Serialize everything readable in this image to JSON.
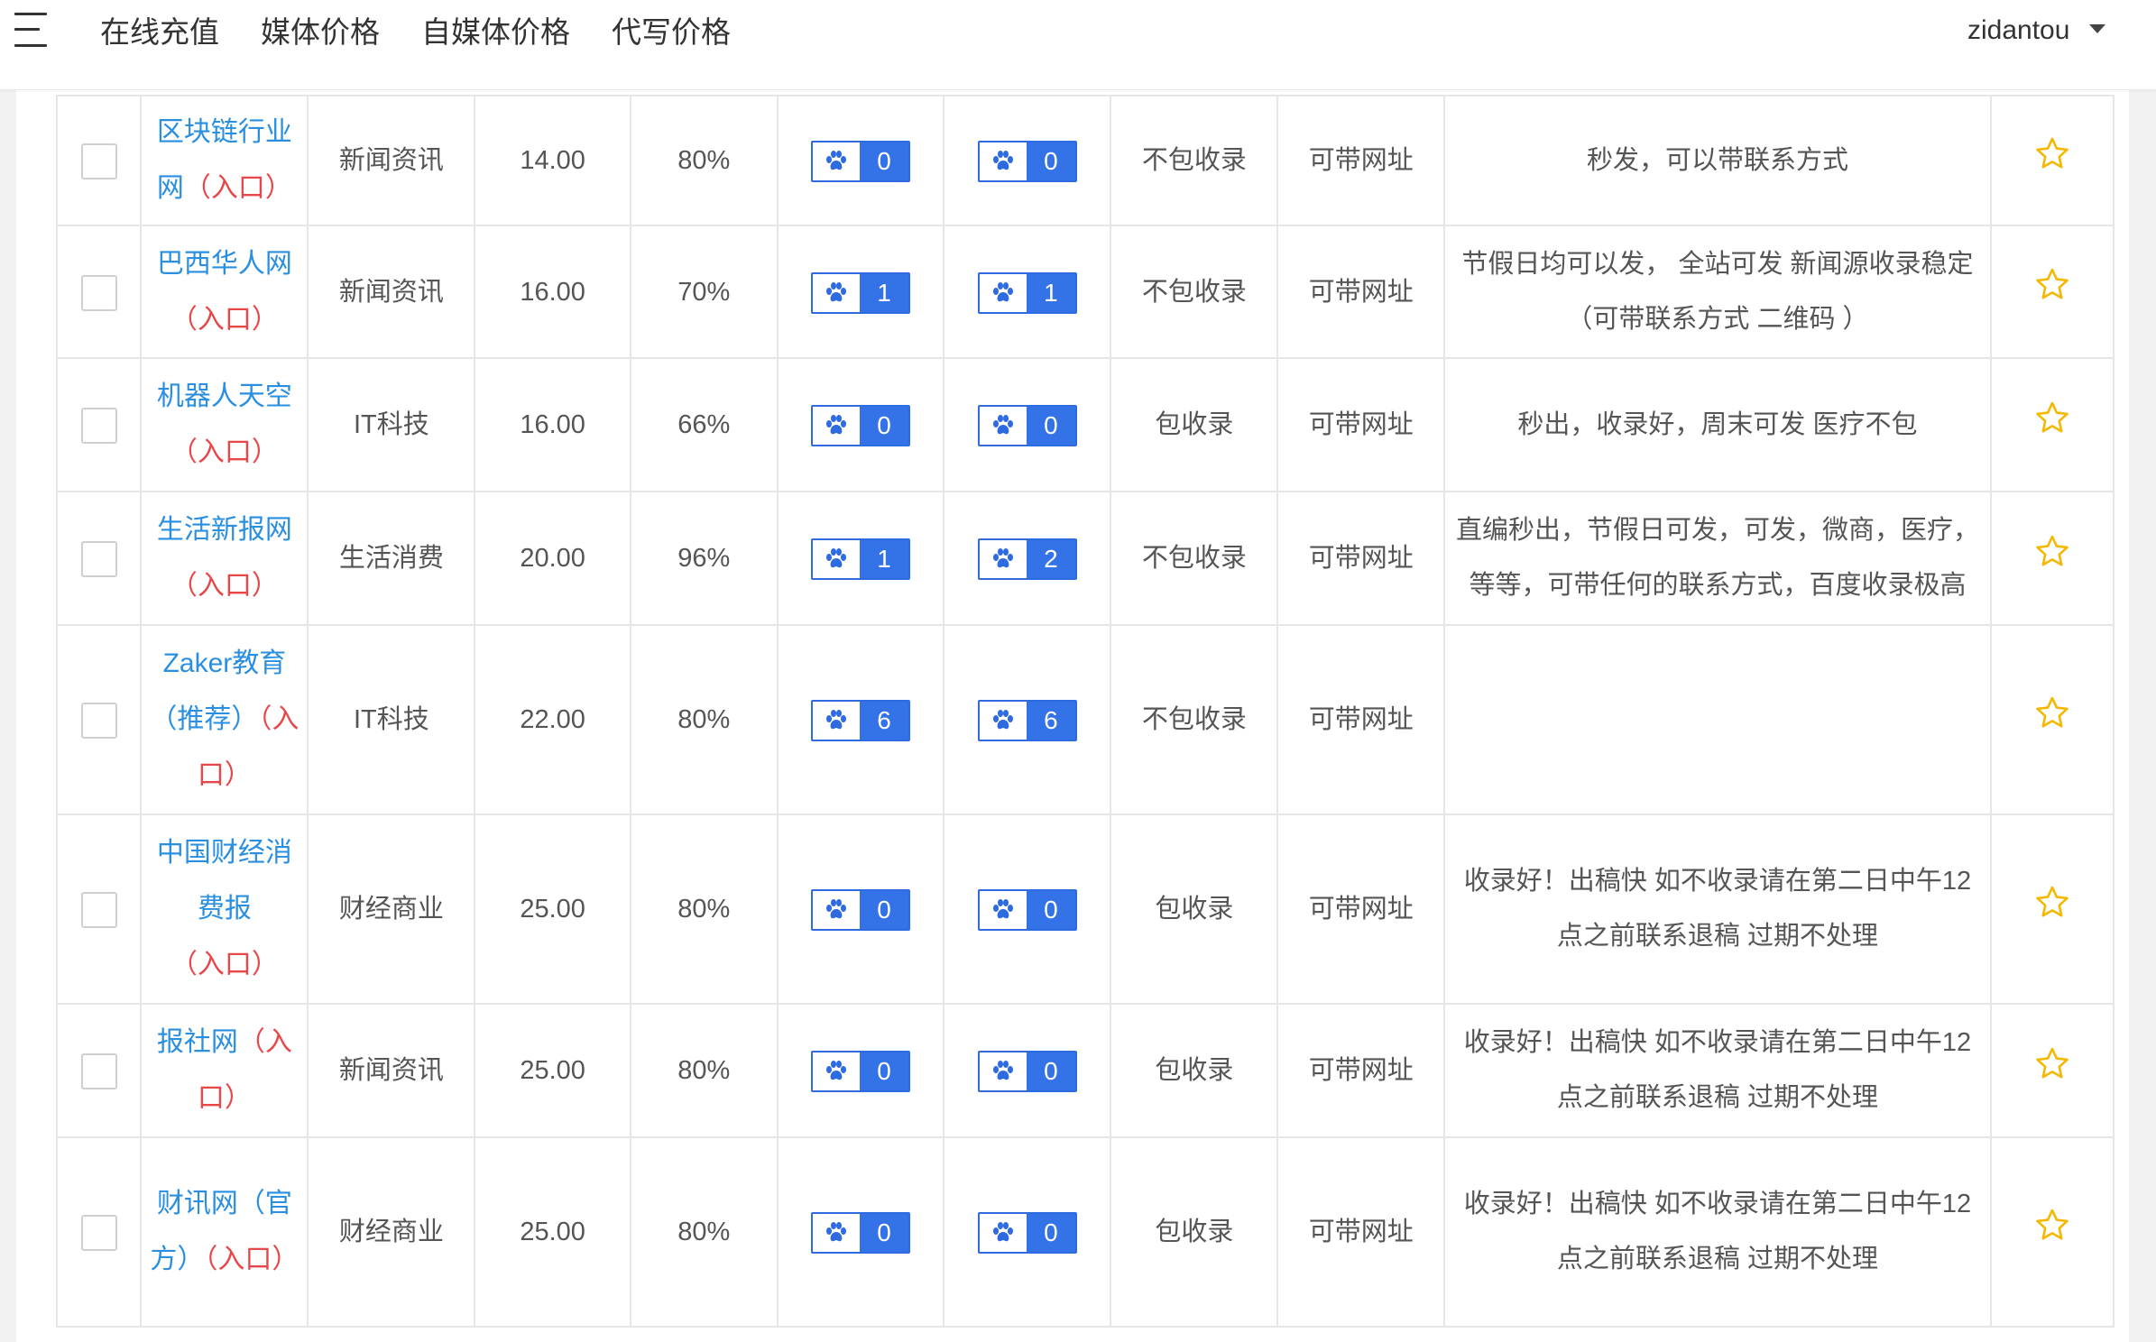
{
  "header": {
    "nav": [
      "在线充值",
      "媒体价格",
      "自媒体价格",
      "代写价格"
    ],
    "username": "zidantou"
  },
  "colors": {
    "link": "#2a8fe0",
    "entry": "#e8474a",
    "badge": "#3472e8",
    "star": "#f5b800"
  },
  "rows": [
    {
      "name": "区块链行业网",
      "entry": "（入口）",
      "category": "新闻资讯",
      "price": "14.00",
      "rate": "80%",
      "baidu_pc": "0",
      "baidu_m": "0",
      "inclusion": "不包收录",
      "link": "可带网址",
      "note": "秒发，可以带联系方式"
    },
    {
      "name": "巴西华人网",
      "entry": "（入口）",
      "category": "新闻资讯",
      "price": "16.00",
      "rate": "70%",
      "baidu_pc": "1",
      "baidu_m": "1",
      "inclusion": "不包收录",
      "link": "可带网址",
      "note": "节假日均可以发， 全站可发 新闻源收录稳定（可带联系方式 二维码 ）"
    },
    {
      "name": "机器人天空",
      "entry": "（入口）",
      "category": "IT科技",
      "price": "16.00",
      "rate": "66%",
      "baidu_pc": "0",
      "baidu_m": "0",
      "inclusion": "包收录",
      "link": "可带网址",
      "note": "秒出，收录好，周末可发 医疗不包"
    },
    {
      "name": "生活新报网",
      "entry": "（入口）",
      "category": "生活消费",
      "price": "20.00",
      "rate": "96%",
      "baidu_pc": "1",
      "baidu_m": "2",
      "inclusion": "不包收录",
      "link": "可带网址",
      "note": "直编秒出，节假日可发，可发，微商，医疗，等等，可带任何的联系方式，百度收录极高"
    },
    {
      "name": "Zaker教育（推荐）",
      "entry": "（入口）",
      "category": "IT科技",
      "price": "22.00",
      "rate": "80%",
      "baidu_pc": "6",
      "baidu_m": "6",
      "inclusion": "不包收录",
      "link": "可带网址",
      "note": ""
    },
    {
      "name": "中国财经消费报",
      "entry": "（入口）",
      "category": "财经商业",
      "price": "25.00",
      "rate": "80%",
      "baidu_pc": "0",
      "baidu_m": "0",
      "inclusion": "包收录",
      "link": "可带网址",
      "note": "收录好！出稿快 如不收录请在第二日中午12点之前联系退稿 过期不处理"
    },
    {
      "name": "报社网",
      "entry": "（入口）",
      "category": "新闻资讯",
      "price": "25.00",
      "rate": "80%",
      "baidu_pc": "0",
      "baidu_m": "0",
      "inclusion": "包收录",
      "link": "可带网址",
      "note": "收录好！出稿快 如不收录请在第二日中午12点之前联系退稿 过期不处理"
    },
    {
      "name": "财讯网（官方）",
      "entry": "（入口）",
      "category": "财经商业",
      "price": "25.00",
      "rate": "80%",
      "baidu_pc": "0",
      "baidu_m": "0",
      "inclusion": "包收录",
      "link": "可带网址",
      "note": "收录好！出稿快 如不收录请在第二日中午12点之前联系退稿 过期不处理"
    }
  ]
}
